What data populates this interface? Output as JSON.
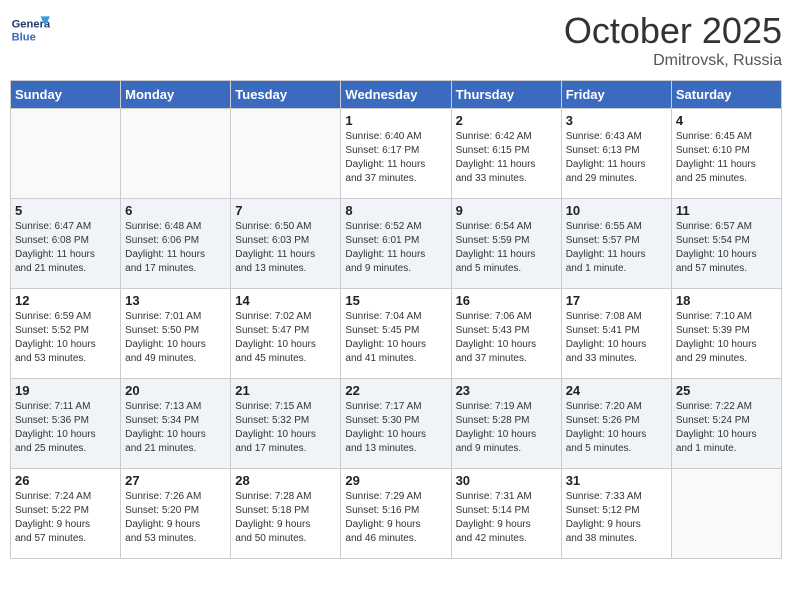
{
  "logo": {
    "line1": "General",
    "line2": "Blue"
  },
  "title": "October 2025",
  "subtitle": "Dmitrovsk, Russia",
  "days_of_week": [
    "Sunday",
    "Monday",
    "Tuesday",
    "Wednesday",
    "Thursday",
    "Friday",
    "Saturday"
  ],
  "weeks": [
    [
      {
        "day": "",
        "info": ""
      },
      {
        "day": "",
        "info": ""
      },
      {
        "day": "",
        "info": ""
      },
      {
        "day": "1",
        "info": "Sunrise: 6:40 AM\nSunset: 6:17 PM\nDaylight: 11 hours\nand 37 minutes."
      },
      {
        "day": "2",
        "info": "Sunrise: 6:42 AM\nSunset: 6:15 PM\nDaylight: 11 hours\nand 33 minutes."
      },
      {
        "day": "3",
        "info": "Sunrise: 6:43 AM\nSunset: 6:13 PM\nDaylight: 11 hours\nand 29 minutes."
      },
      {
        "day": "4",
        "info": "Sunrise: 6:45 AM\nSunset: 6:10 PM\nDaylight: 11 hours\nand 25 minutes."
      }
    ],
    [
      {
        "day": "5",
        "info": "Sunrise: 6:47 AM\nSunset: 6:08 PM\nDaylight: 11 hours\nand 21 minutes."
      },
      {
        "day": "6",
        "info": "Sunrise: 6:48 AM\nSunset: 6:06 PM\nDaylight: 11 hours\nand 17 minutes."
      },
      {
        "day": "7",
        "info": "Sunrise: 6:50 AM\nSunset: 6:03 PM\nDaylight: 11 hours\nand 13 minutes."
      },
      {
        "day": "8",
        "info": "Sunrise: 6:52 AM\nSunset: 6:01 PM\nDaylight: 11 hours\nand 9 minutes."
      },
      {
        "day": "9",
        "info": "Sunrise: 6:54 AM\nSunset: 5:59 PM\nDaylight: 11 hours\nand 5 minutes."
      },
      {
        "day": "10",
        "info": "Sunrise: 6:55 AM\nSunset: 5:57 PM\nDaylight: 11 hours\nand 1 minute."
      },
      {
        "day": "11",
        "info": "Sunrise: 6:57 AM\nSunset: 5:54 PM\nDaylight: 10 hours\nand 57 minutes."
      }
    ],
    [
      {
        "day": "12",
        "info": "Sunrise: 6:59 AM\nSunset: 5:52 PM\nDaylight: 10 hours\nand 53 minutes."
      },
      {
        "day": "13",
        "info": "Sunrise: 7:01 AM\nSunset: 5:50 PM\nDaylight: 10 hours\nand 49 minutes."
      },
      {
        "day": "14",
        "info": "Sunrise: 7:02 AM\nSunset: 5:47 PM\nDaylight: 10 hours\nand 45 minutes."
      },
      {
        "day": "15",
        "info": "Sunrise: 7:04 AM\nSunset: 5:45 PM\nDaylight: 10 hours\nand 41 minutes."
      },
      {
        "day": "16",
        "info": "Sunrise: 7:06 AM\nSunset: 5:43 PM\nDaylight: 10 hours\nand 37 minutes."
      },
      {
        "day": "17",
        "info": "Sunrise: 7:08 AM\nSunset: 5:41 PM\nDaylight: 10 hours\nand 33 minutes."
      },
      {
        "day": "18",
        "info": "Sunrise: 7:10 AM\nSunset: 5:39 PM\nDaylight: 10 hours\nand 29 minutes."
      }
    ],
    [
      {
        "day": "19",
        "info": "Sunrise: 7:11 AM\nSunset: 5:36 PM\nDaylight: 10 hours\nand 25 minutes."
      },
      {
        "day": "20",
        "info": "Sunrise: 7:13 AM\nSunset: 5:34 PM\nDaylight: 10 hours\nand 21 minutes."
      },
      {
        "day": "21",
        "info": "Sunrise: 7:15 AM\nSunset: 5:32 PM\nDaylight: 10 hours\nand 17 minutes."
      },
      {
        "day": "22",
        "info": "Sunrise: 7:17 AM\nSunset: 5:30 PM\nDaylight: 10 hours\nand 13 minutes."
      },
      {
        "day": "23",
        "info": "Sunrise: 7:19 AM\nSunset: 5:28 PM\nDaylight: 10 hours\nand 9 minutes."
      },
      {
        "day": "24",
        "info": "Sunrise: 7:20 AM\nSunset: 5:26 PM\nDaylight: 10 hours\nand 5 minutes."
      },
      {
        "day": "25",
        "info": "Sunrise: 7:22 AM\nSunset: 5:24 PM\nDaylight: 10 hours\nand 1 minute."
      }
    ],
    [
      {
        "day": "26",
        "info": "Sunrise: 7:24 AM\nSunset: 5:22 PM\nDaylight: 9 hours\nand 57 minutes."
      },
      {
        "day": "27",
        "info": "Sunrise: 7:26 AM\nSunset: 5:20 PM\nDaylight: 9 hours\nand 53 minutes."
      },
      {
        "day": "28",
        "info": "Sunrise: 7:28 AM\nSunset: 5:18 PM\nDaylight: 9 hours\nand 50 minutes."
      },
      {
        "day": "29",
        "info": "Sunrise: 7:29 AM\nSunset: 5:16 PM\nDaylight: 9 hours\nand 46 minutes."
      },
      {
        "day": "30",
        "info": "Sunrise: 7:31 AM\nSunset: 5:14 PM\nDaylight: 9 hours\nand 42 minutes."
      },
      {
        "day": "31",
        "info": "Sunrise: 7:33 AM\nSunset: 5:12 PM\nDaylight: 9 hours\nand 38 minutes."
      },
      {
        "day": "",
        "info": ""
      }
    ]
  ]
}
